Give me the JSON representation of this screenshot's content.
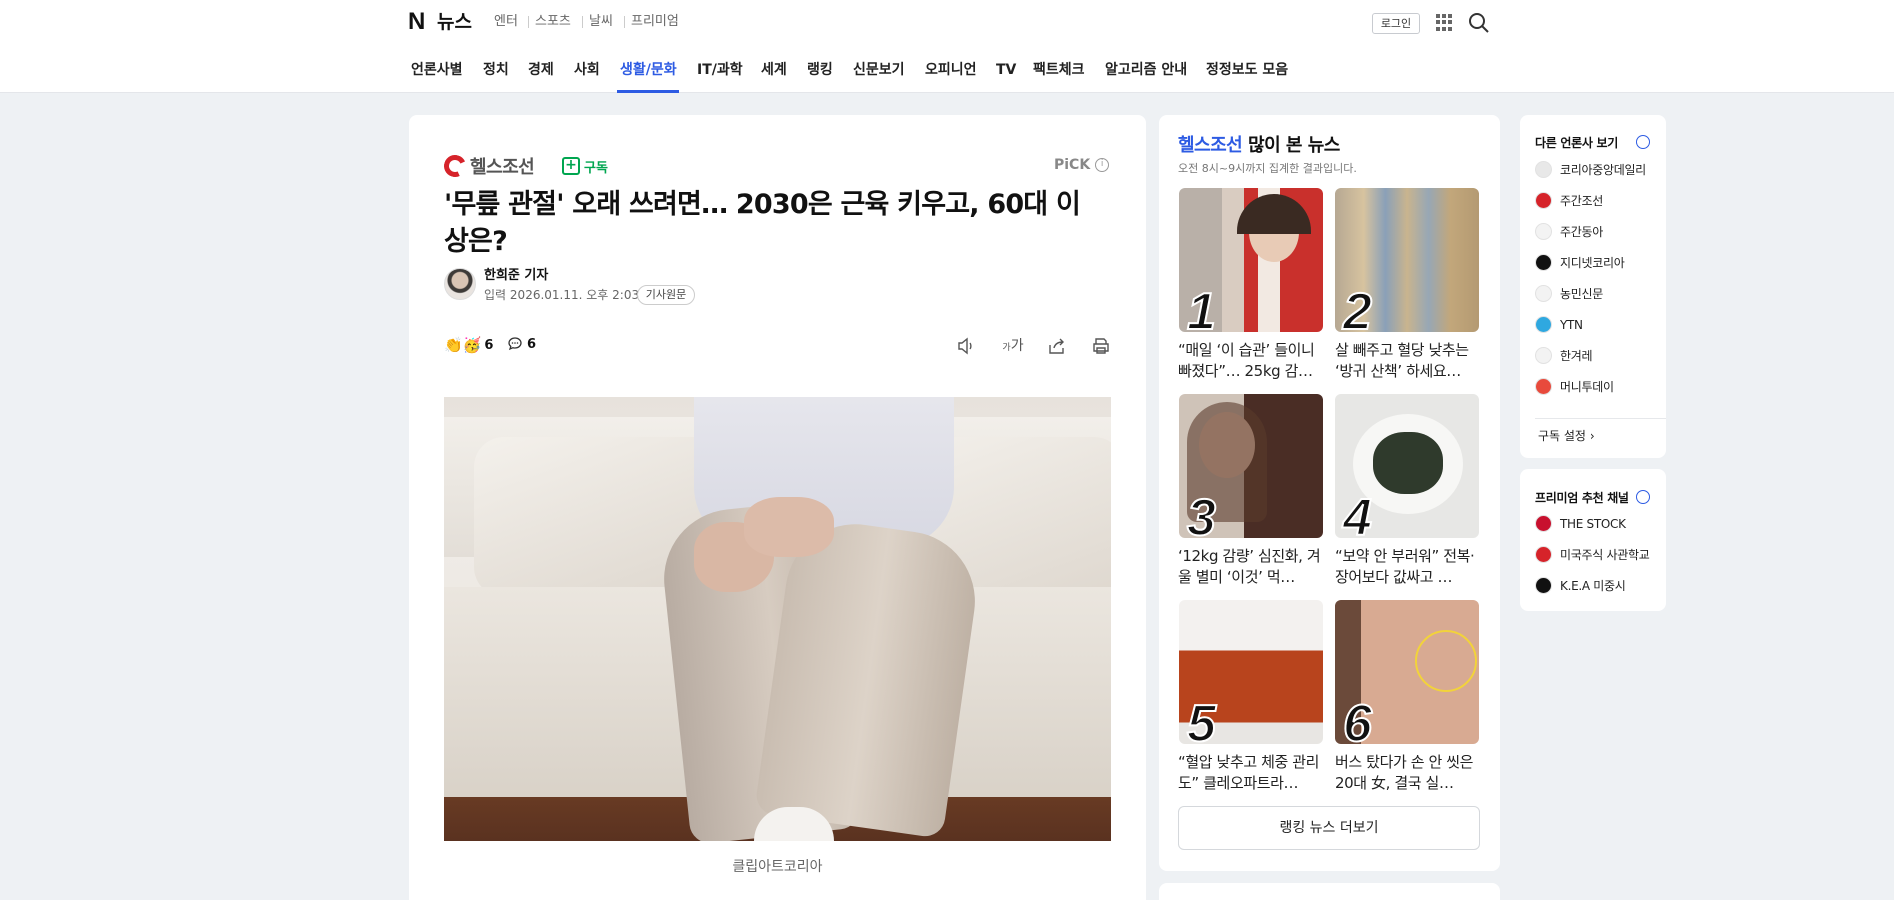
{
  "header": {
    "logo": "N",
    "service": "뉴스",
    "services": [
      "엔터",
      "스포츠",
      "날씨",
      "프리미엄"
    ],
    "login": "로그인",
    "menu": [
      "언론사별",
      "정치",
      "경제",
      "사회",
      "생활/문화",
      "IT/과학",
      "세계",
      "랭킹",
      "신문보기",
      "오피니언",
      "TV",
      "팩트체크",
      "알고리즘 안내",
      "정정보도 모음"
    ],
    "active_menu": "생활/문화"
  },
  "article": {
    "press": "헬스조선",
    "subscribe": "구독",
    "pick": "PiCK",
    "title": "'무릎 관절' 오래 쓰려면… 2030은 근육 키우고, 60대 이상은?",
    "reporter": "한희준 기자",
    "date_label": "입력",
    "date": "2026.01.11. 오후 2:03",
    "original_button": "기사원문",
    "reaction_count": "6",
    "comment_count": "6",
    "font_button": "가",
    "caption": "클립아트코리아"
  },
  "ranking": {
    "press": "헬스조선",
    "title": "많이 본 뉴스",
    "subtitle": "오전 8시~9시까지 집계한 결과입니다.",
    "items": [
      {
        "rank": "1",
        "text": "“매일 ‘이 습관’ 들이니 빠졌다”… 25kg 감…"
      },
      {
        "rank": "2",
        "text": "살 빼주고 혈당 낮추는 ‘방귀 산책’ 하세요…"
      },
      {
        "rank": "3",
        "text": "‘12kg 감량’ 심진화, 겨울 별미 ‘이것’ 먹…"
      },
      {
        "rank": "4",
        "text": "“보약 안 부러워” 전복·장어보다 값싸고 …"
      },
      {
        "rank": "5",
        "text": "“혈압 낮추고 체중 관리도” 클레오파트라…"
      },
      {
        "rank": "6",
        "text": "버스 탔다가 손 안 씻은 20대 女, 결국 실…"
      }
    ],
    "more": "랭킹 뉴스 더보기"
  },
  "other_press": {
    "title": "다른 언론사 보기",
    "items": [
      {
        "name": "코리아중앙데일리",
        "color": "#e8e8e8"
      },
      {
        "name": "주간조선",
        "color": "#d6232a"
      },
      {
        "name": "주간동아",
        "color": "#f3f3f3"
      },
      {
        "name": "지디넷코리아",
        "color": "#111111"
      },
      {
        "name": "농민신문",
        "color": "#f3f3f3"
      },
      {
        "name": "YTN",
        "color": "#2fa8e0"
      },
      {
        "name": "한겨레",
        "color": "#f3f3f3"
      },
      {
        "name": "머니투데이",
        "color": "#e84a3c"
      }
    ],
    "settings": "구독 설정"
  },
  "premium": {
    "title": "프리미엄 추천 채널",
    "items": [
      {
        "name": "THE STOCK",
        "color": "#c8102e"
      },
      {
        "name": "미국주식 사관학교",
        "color": "#d6232a"
      },
      {
        "name": "K.E.A 미중시",
        "color": "#111111"
      }
    ]
  }
}
